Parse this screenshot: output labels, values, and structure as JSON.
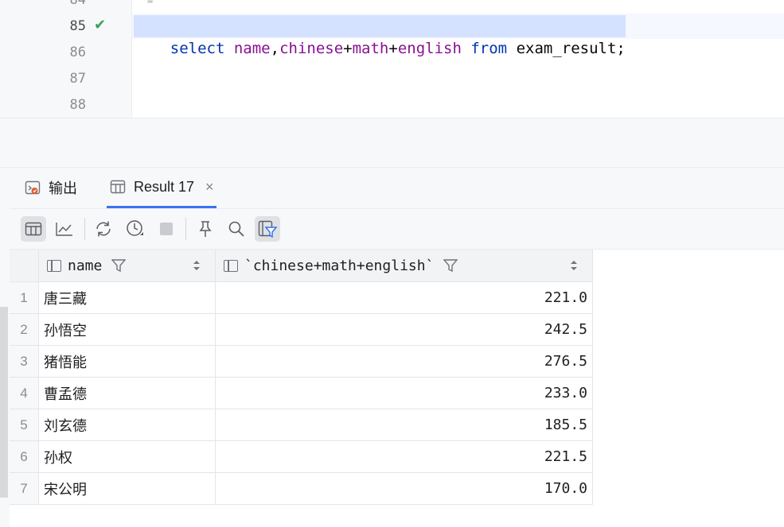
{
  "editor": {
    "line_numbers": [
      "84",
      "85",
      "86",
      "87",
      "88"
    ],
    "active_line": "85",
    "top_fragment": "=",
    "code_tokens": [
      {
        "text": "select",
        "cls": "kw"
      },
      {
        "text": " ",
        "cls": "id"
      },
      {
        "text": "name",
        "cls": "fn"
      },
      {
        "text": ",",
        "cls": "op"
      },
      {
        "text": "chinese",
        "cls": "fn"
      },
      {
        "text": "+",
        "cls": "op"
      },
      {
        "text": "math",
        "cls": "fn"
      },
      {
        "text": "+",
        "cls": "op"
      },
      {
        "text": "english",
        "cls": "fn"
      },
      {
        "text": " ",
        "cls": "id"
      },
      {
        "text": "from",
        "cls": "kw"
      },
      {
        "text": " exam_result;",
        "cls": "id"
      }
    ]
  },
  "tabs": [
    {
      "label": "输出",
      "icon": "output-icon"
    },
    {
      "label": "Result 17",
      "icon": "table-icon",
      "close": "×"
    }
  ],
  "toolbar": {
    "buttons": [
      "table-view-icon",
      "chart-view-icon",
      "refresh-icon",
      "history-icon",
      "stop-icon",
      "pin-icon",
      "search-icon",
      "filter-view-icon"
    ]
  },
  "grid": {
    "columns": [
      "name",
      "`chinese+math+english`"
    ],
    "rows": [
      {
        "n": "1",
        "name": "唐三藏",
        "total": "221.0"
      },
      {
        "n": "2",
        "name": "孙悟空",
        "total": "242.5"
      },
      {
        "n": "3",
        "name": "猪悟能",
        "total": "276.5"
      },
      {
        "n": "4",
        "name": "曹孟德",
        "total": "233.0"
      },
      {
        "n": "5",
        "name": "刘玄德",
        "total": "185.5"
      },
      {
        "n": "6",
        "name": "孙权",
        "total": "221.5"
      },
      {
        "n": "7",
        "name": "宋公明",
        "total": "170.0"
      }
    ]
  },
  "colors": {
    "accent": "#3574f0",
    "keyword": "#0033b3",
    "identifier": "#871094",
    "success_check": "#3f9e5a"
  }
}
